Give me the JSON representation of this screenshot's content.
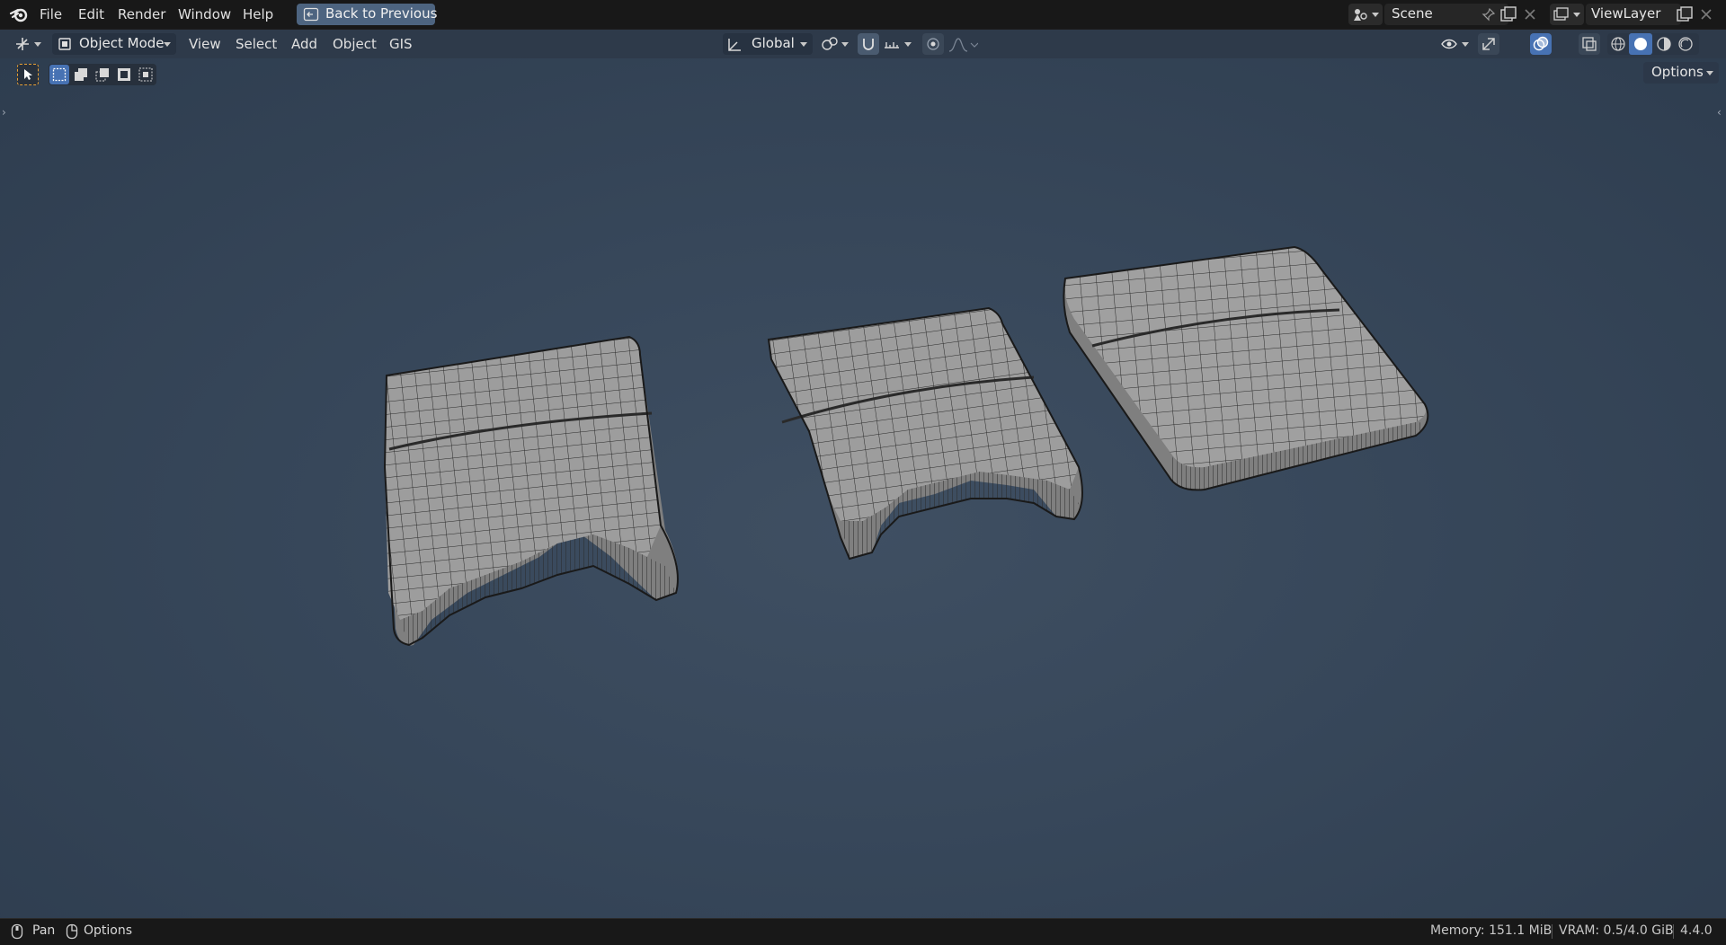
{
  "topbar": {
    "menus": [
      "File",
      "Edit",
      "Render",
      "Window",
      "Help"
    ],
    "back_button": "Back to Previous",
    "scene_name": "Scene",
    "view_layer": "ViewLayer"
  },
  "header": {
    "mode": "Object Mode",
    "menus": [
      "View",
      "Select",
      "Add",
      "Object",
      "GIS"
    ],
    "orientation": "Global",
    "options_label": "Options"
  },
  "status": {
    "pan_label": "Pan",
    "options_label": "Options",
    "memory": "Memory: 151.1 MiB",
    "vram": "VRAM: 0.5/4.0 GiB",
    "version": "4.4.0"
  },
  "icons": [
    "blender-logo-icon",
    "back-icon",
    "scene-icon",
    "pin-icon",
    "new-scene-icon",
    "delete-icon",
    "view-layer-icon",
    "editor-type-icon",
    "object-mode-icon",
    "transform-orientation-icon",
    "pivot-icon",
    "snap-icon",
    "proportional-edit-icon",
    "visibility-icon",
    "gizmo-icon",
    "overlay-icon",
    "xray-icon",
    "wireframe-shading-icon",
    "solid-shading-icon",
    "material-shading-icon",
    "rendered-shading-icon",
    "select-box-icon",
    "mouse-left-icon",
    "mouse-right-icon"
  ],
  "colors": {
    "accent": "#4772b3",
    "viewport_bg": "#3b4a5d",
    "header_bg": "#2e3a4a",
    "mesh_fill": "#9c9c9c"
  }
}
